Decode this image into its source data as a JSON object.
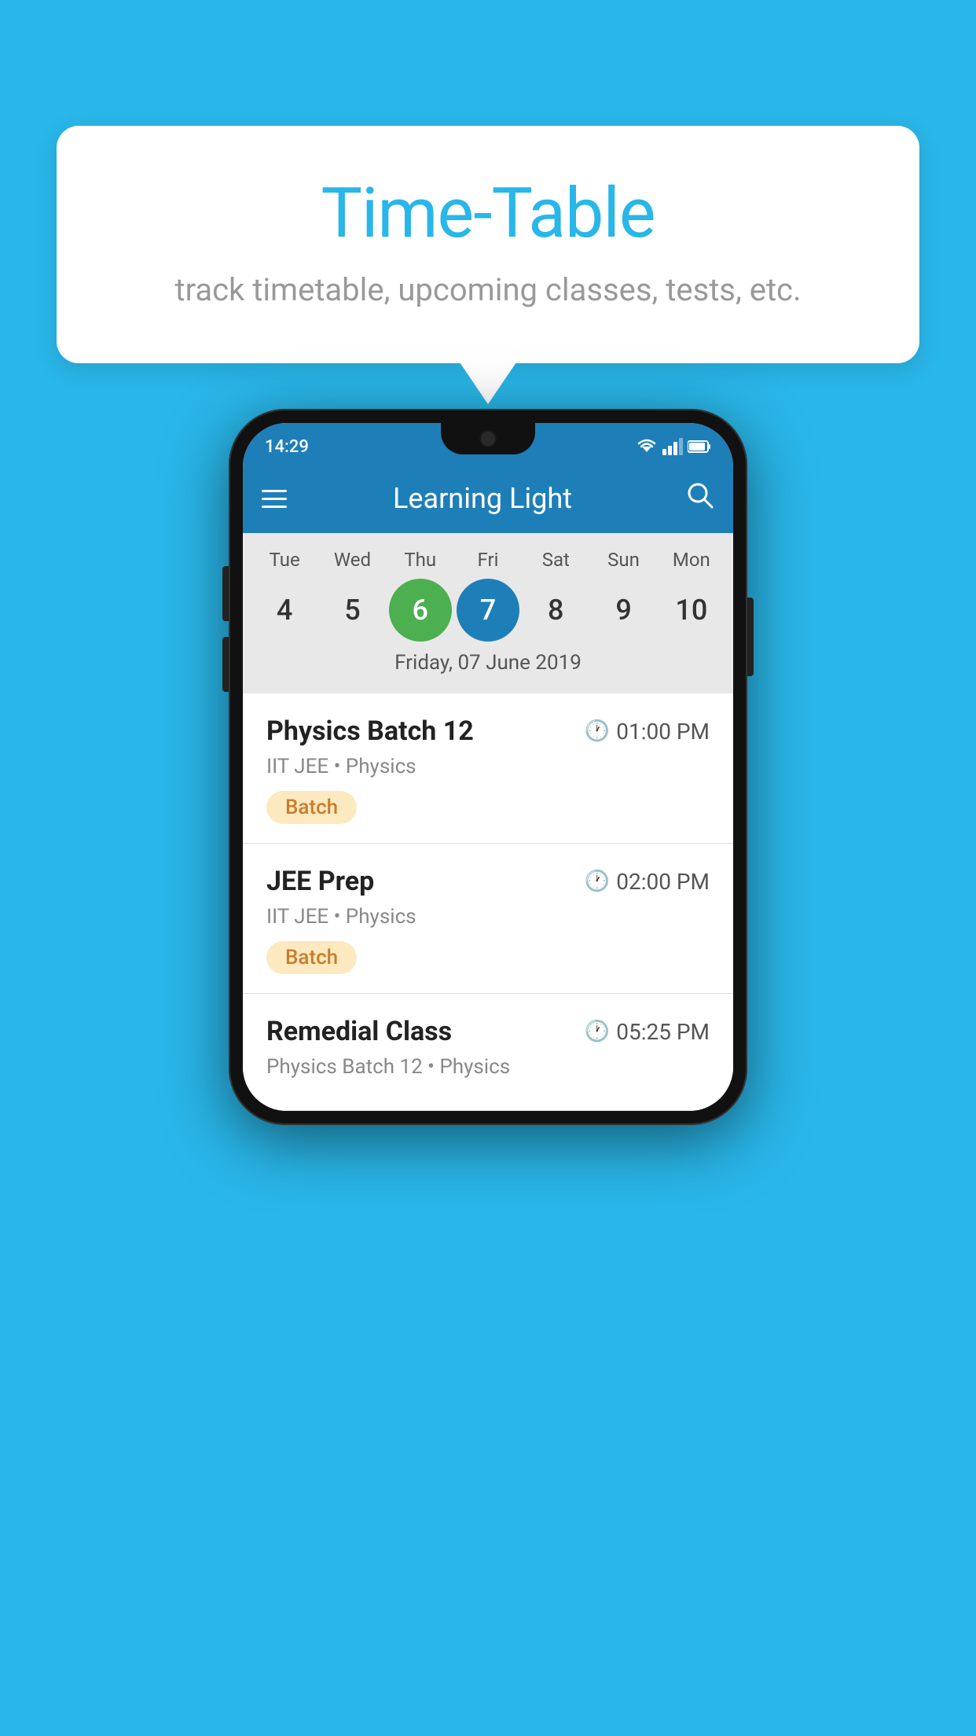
{
  "background": {
    "color": "#29b6e8"
  },
  "speech_bubble": {
    "title": "Time-Table",
    "subtitle": "track timetable, upcoming classes, tests, etc."
  },
  "phone": {
    "status_bar": {
      "time": "14:29"
    },
    "header": {
      "title": "Learning Light"
    },
    "calendar": {
      "days": [
        {
          "label": "Tue",
          "num": "4"
        },
        {
          "label": "Wed",
          "num": "5"
        },
        {
          "label": "Thu",
          "num": "6",
          "state": "today"
        },
        {
          "label": "Fri",
          "num": "7",
          "state": "selected"
        },
        {
          "label": "Sat",
          "num": "8"
        },
        {
          "label": "Sun",
          "num": "9"
        },
        {
          "label": "Mon",
          "num": "10"
        }
      ],
      "selected_date": "Friday, 07 June 2019"
    },
    "classes": [
      {
        "name": "Physics Batch 12",
        "time": "01:00 PM",
        "subject": "IIT JEE • Physics",
        "badge": "Batch"
      },
      {
        "name": "JEE Prep",
        "time": "02:00 PM",
        "subject": "IIT JEE • Physics",
        "badge": "Batch"
      },
      {
        "name": "Remedial Class",
        "time": "05:25 PM",
        "subject": "Physics Batch 12 • Physics",
        "badge": ""
      }
    ]
  }
}
